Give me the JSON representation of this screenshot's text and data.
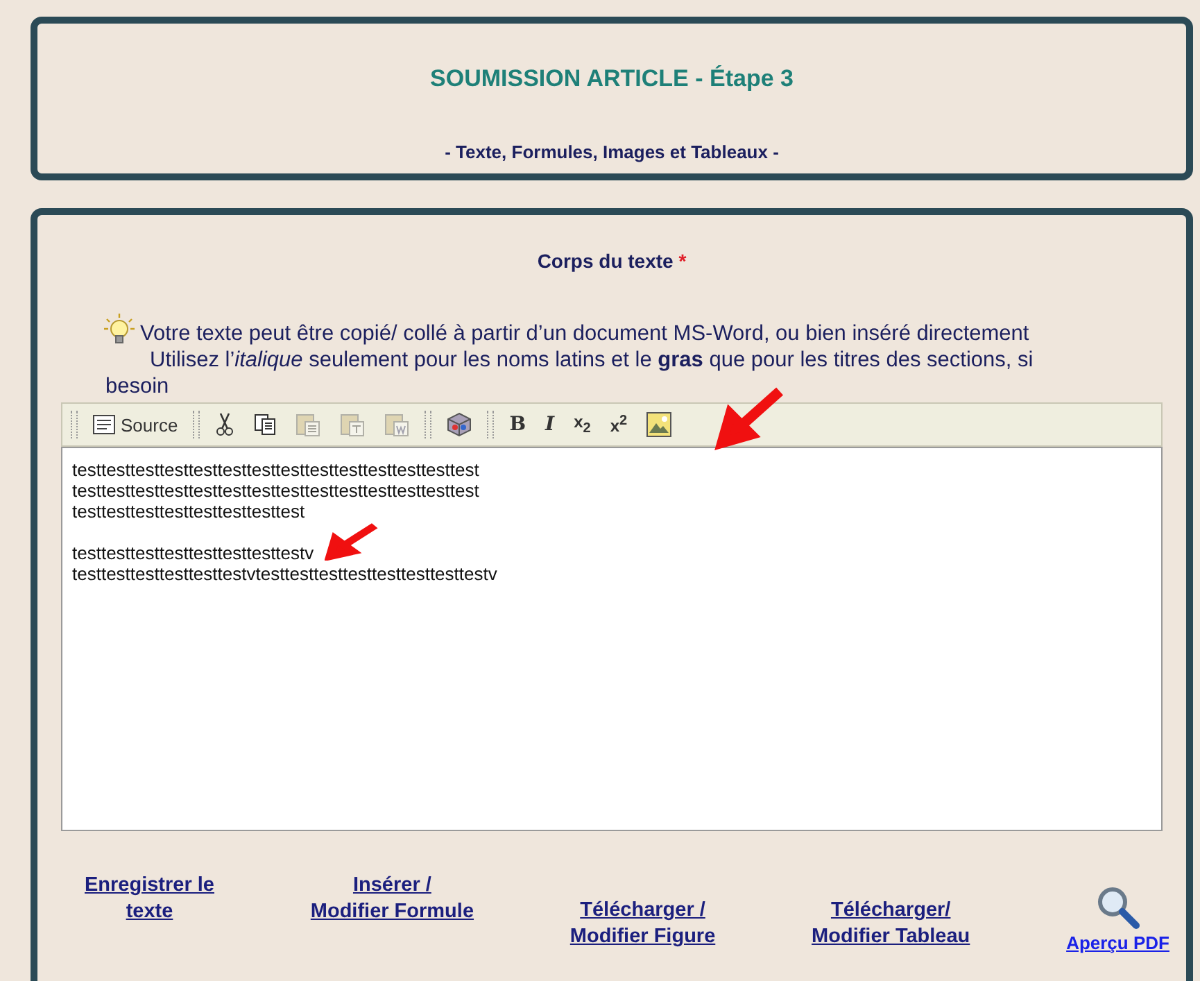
{
  "header": {
    "title": "SOUMISSION ARTICLE - Étape 3",
    "subtitle": "- Texte, Formules, Images et Tableaux -"
  },
  "section": {
    "title": "Corps du texte",
    "required_mark": "*"
  },
  "instructions": [
    "Votre texte peut être copié/ collé à partir d’un document MS-Word, ou bien inséré directement",
    "Utilisez l’*italique* seulement pour les noms latins et le **gras** que pour les titres des sections, si besoin"
  ],
  "toolbar": [
    {
      "kind": "source",
      "label": "Source",
      "disabled": false
    },
    {
      "kind": "separator"
    },
    {
      "kind": "cut",
      "disabled": false
    },
    {
      "kind": "copy",
      "disabled": false
    },
    {
      "kind": "paste",
      "disabled": true
    },
    {
      "kind": "paste-text",
      "disabled": true
    },
    {
      "kind": "paste-word",
      "disabled": true
    },
    {
      "kind": "separator"
    },
    {
      "kind": "template",
      "disabled": false
    },
    {
      "kind": "separator"
    },
    {
      "kind": "bold",
      "label": "B",
      "disabled": false
    },
    {
      "kind": "italic",
      "label": "I",
      "disabled": false
    },
    {
      "kind": "subscript",
      "label": "x$_{2}$",
      "disabled": false
    },
    {
      "kind": "superscript",
      "label": "x$^{2}$",
      "disabled": false
    },
    {
      "kind": "image",
      "disabled": false
    }
  ],
  "editor_paragraphs": [
    [
      "testtesttesttesttesttesttesttesttesttesttesttesttesttest",
      "testtesttesttesttesttesttesttesttesttesttesttesttesttest",
      "testtesttesttesttesttesttesttest"
    ],
    [
      "testtesttesttesttesttesttesttestv",
      "testtesttesttesttesttestvtesttesttesttesttesttesttesttestv"
    ]
  ],
  "actions": [
    {
      "kind": "link",
      "label": "Enregistrer le\ntexte"
    },
    {
      "kind": "link",
      "label": "Insérer /\nModifier Formule"
    },
    {
      "kind": "link",
      "label": "Télécharger /\nModifier Figure"
    },
    {
      "kind": "link",
      "label": "Télécharger/\nModifier Tableau"
    },
    {
      "kind": "preview",
      "label": "Aperçu PDF"
    }
  ]
}
